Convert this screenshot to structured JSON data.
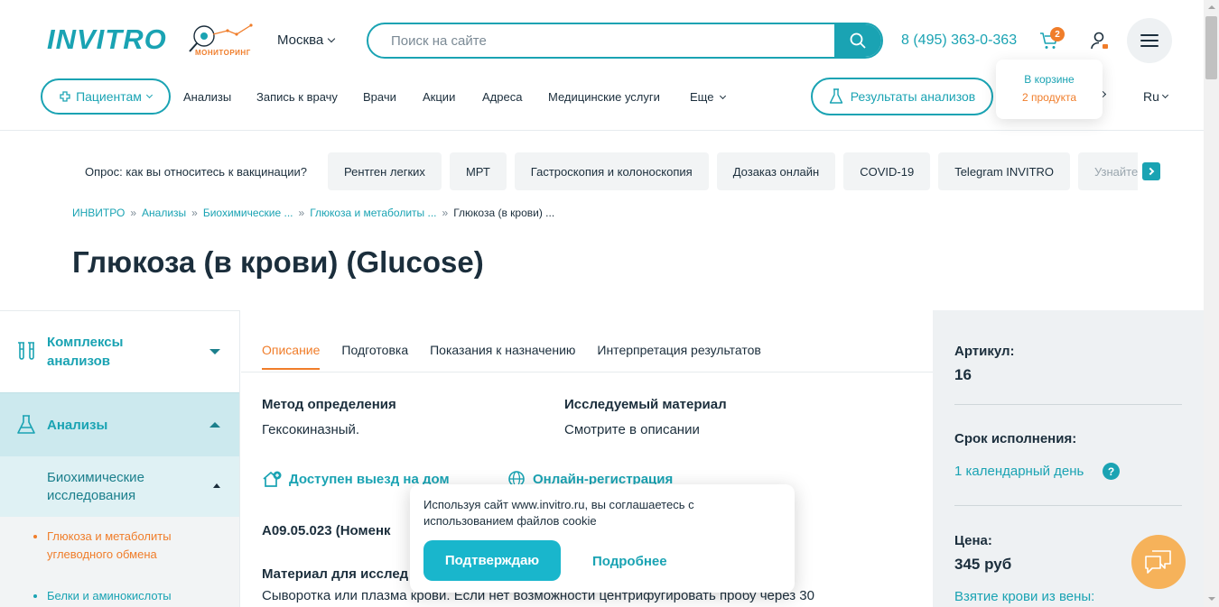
{
  "header": {
    "logo": "INVITRO",
    "monitoring_label": "МОНИТОРИНГ",
    "city": "Москва",
    "search_placeholder": "Поиск на сайте",
    "phone": "8 (495) 363-0-363",
    "cart_count": "2"
  },
  "nav": {
    "patients": "Пациентам",
    "items": [
      "Анализы",
      "Запись к врачу",
      "Врачи",
      "Акции",
      "Адреса",
      "Медицинские услуги",
      "Еще"
    ],
    "results": "Результаты анализов",
    "lang": "Ru"
  },
  "cart_popup": {
    "line1": "В корзине",
    "line2": "2 продукта"
  },
  "chips": [
    "Опрос: как вы относитесь к вакцинации?",
    "Рентген легких",
    "МРТ",
    "Гастроскопия и колоноскопия",
    "Дозаказ онлайн",
    "COVID-19",
    "Telegram INVITRO",
    "Узнайте"
  ],
  "breadcrumbs": [
    "ИНВИТРО",
    "Анализы",
    "Биохимические ...",
    "Глюкоза и метаболиты ...",
    "Глюкоза (в крови) ..."
  ],
  "page_title": "Глюкоза (в крови) (Glucose)",
  "sidebar": {
    "complexes": "Комплексы анализов",
    "analyses": "Анализы",
    "biochem": "Биохимические исследования",
    "sub_items": [
      "Глюкоза и метаболиты углеводного обмена",
      "Белки и аминокислоты"
    ]
  },
  "tabs": [
    "Описание",
    "Подготовка",
    "Показания к назначению",
    "Интерпретация результатов"
  ],
  "content": {
    "method_h": "Метод определения",
    "method_v": "Гексокиназный.",
    "material_h": "Исследуемый материал",
    "material_v": "Смотрите в описании",
    "home_visit": "Доступен выезд на дом",
    "online_reg": "Онлайн-регистрация",
    "code": "A09.05.023 (Номенк",
    "material2_h": "Материал для исслед",
    "material2_v": "Сыворотка или плазма крови. Если нет возможности центрифугировать пробу через 30"
  },
  "right_panel": {
    "article_h": "Артикул:",
    "article_v": "16",
    "term_h": "Срок исполнения:",
    "term_v": "1 календарный день",
    "price_h": "Цена:",
    "price_v": "345 руб",
    "blood_link": "Взятие крови из вены:"
  },
  "cookie": {
    "text": "Используя сайт www.invitro.ru, вы соглашаетесь с использованием файлов cookie",
    "confirm": "Подтверждаю",
    "more": "Подробнее"
  },
  "colors": {
    "accent": "#1aa3b3",
    "orange": "#f07d2a"
  }
}
